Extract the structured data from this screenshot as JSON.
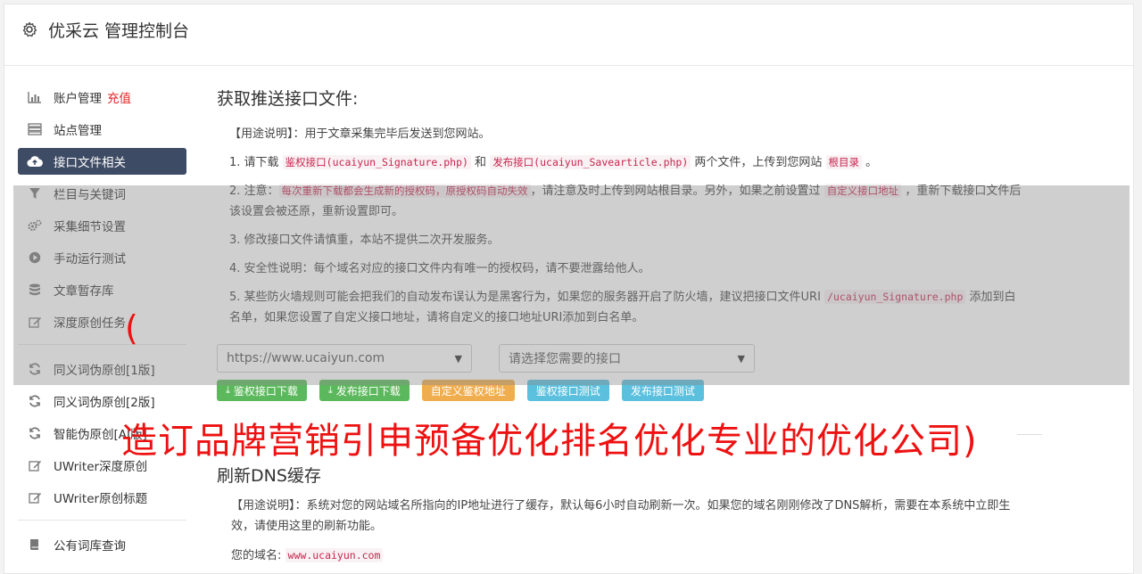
{
  "header": {
    "title": "优采云 管理控制台",
    "icon": "gear-icon"
  },
  "sidebar": {
    "items": [
      {
        "label": "账户管理",
        "badge": "充值",
        "icon": "bar-chart-icon"
      },
      {
        "label": "站点管理",
        "icon": "server-icon"
      },
      {
        "label": "接口文件相关",
        "icon": "cloud-upload-icon",
        "active": true
      },
      {
        "label": "栏目与关键词",
        "icon": "filter-icon"
      },
      {
        "label": "采集细节设置",
        "icon": "cogs-icon"
      },
      {
        "label": "手动运行测试",
        "icon": "play-circle-icon"
      },
      {
        "label": "文章暂存库",
        "icon": "database-icon"
      },
      {
        "label": "深度原创任务",
        "icon": "edit-icon"
      },
      {
        "label": "同义词伪原创[1版]",
        "icon": "refresh-icon"
      },
      {
        "label": "同义词伪原创[2版]",
        "icon": "refresh-icon"
      },
      {
        "label": "智能伪原创[AI版]",
        "icon": "refresh-icon"
      },
      {
        "label": "UWriter深度原创",
        "icon": "edit-icon"
      },
      {
        "label": "UWriter原创标题",
        "icon": "edit-icon"
      },
      {
        "label": "公有词库查询",
        "icon": "book-icon"
      }
    ]
  },
  "main": {
    "title": "获取推送接口文件:",
    "usage": "【用途说明】：用于文章采集完毕后发送到您网站。",
    "p1": {
      "a": "1. 请下载 ",
      "c1": "鉴权接口(ucaiyun_Signature.php)",
      "b": " 和 ",
      "c2": "发布接口(ucaiyun_Savearticle.php)",
      "d": " 两个文件，上传到您网站 ",
      "c3": "根目录",
      "e": " 。"
    },
    "p2": {
      "a": "2. 注意：",
      "c1": "每次重新下载都会生成新的授权码，原授权码自动失效",
      "b": "，请注意及时上传到网站根目录。另外，如果之前设置过 ",
      "c2": "自定义接口地址",
      "d": " ，重新下载接口文件后该设置会被还原，重新设置即可。"
    },
    "p3": "3. 修改接口文件请慎重，本站不提供二次开发服务。",
    "p4": "4. 安全性说明：每个域名对应的接口文件内有唯一的授权码，请不要泄露给他人。",
    "p5": {
      "a": "5. 某些防火墙规则可能会把我们的自动发布误认为是黑客行为，如果您的服务器开启了防火墙，建议把接口文件URI ",
      "c1": "/ucaiyun_Signature.php",
      "b": " 添加到白名单，如果您设置了自定义接口地址，请将自定义的接口地址URI添加到白名单。"
    },
    "site_select": "https://www.ucaiyun.com",
    "api_select": "请选择您需要的接口",
    "buttons": {
      "b1": "鉴权接口下载",
      "b2": "发布接口下载",
      "b3": "自定义鉴权地址",
      "b4": "鉴权接口测试",
      "b5": "发布接口测试"
    }
  },
  "dns": {
    "title": "刷新DNS缓存",
    "usage": "【用途说明】：系统对您的网站域名所指向的IP地址进行了缓存，默认每6小时自动刷新一次。如果您的域名刚刚修改了DNS解析，需要在本系统中立即生效，请使用这里的刷新功能。",
    "domain_label": "您的域名:",
    "domain_value": "www.ucaiyun.com"
  },
  "watermark": {
    "paren": "(",
    "banner": "造订品牌营销引申预备优化排名优化专业的优化公司)"
  }
}
